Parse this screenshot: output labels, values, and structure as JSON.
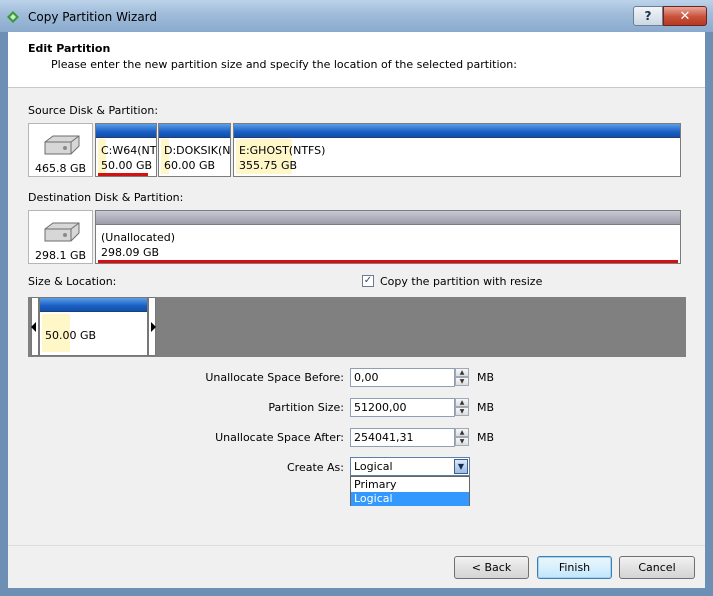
{
  "window": {
    "title": "Copy Partition Wizard",
    "help_glyph": "?",
    "close_glyph": "✕"
  },
  "header": {
    "title": "Edit Partition",
    "description": "Please enter the new partition size and specify the location of the selected partition:"
  },
  "source": {
    "label": "Source Disk & Partition:",
    "disk_size": "465.8 GB",
    "partitions": [
      {
        "name": "C:W64(NT",
        "size": "50.00 GB",
        "selected": true
      },
      {
        "name": "D:DOKSIK(N",
        "size": "60.00 GB",
        "selected": false
      },
      {
        "name": "E:GHOST(NTFS)",
        "size": "355.75 GB",
        "selected": false
      }
    ]
  },
  "destination": {
    "label": "Destination Disk & Partition:",
    "disk_size": "298.1 GB",
    "partition": {
      "name": "(Unallocated)",
      "size": "298.09 GB"
    }
  },
  "size_location": {
    "label": "Size & Location:",
    "partition_size": "50.00 GB",
    "copy_with_resize": {
      "label": "Copy the partition with resize",
      "checked": true
    }
  },
  "fields": {
    "before": {
      "label": "Unallocate Space Before:",
      "value": "0,00",
      "unit": "MB"
    },
    "size": {
      "label": "Partition Size:",
      "value": "51200,00",
      "unit": "MB"
    },
    "after": {
      "label": "Unallocate Space After:",
      "value": "254041,31",
      "unit": "MB"
    },
    "create_as": {
      "label": "Create As:",
      "value": "Logical",
      "options": [
        "Primary",
        "Logical"
      ],
      "highlighted": "Logical"
    }
  },
  "buttons": {
    "back": "< Back",
    "finish": "Finish",
    "cancel": "Cancel"
  },
  "colors": {
    "partition_bar": "#1a5fc4",
    "unallocated_bar": "#9c9caa",
    "used_line": "#d41010",
    "highlight_fill": "#fff7c8",
    "selection": "#3399ff"
  }
}
